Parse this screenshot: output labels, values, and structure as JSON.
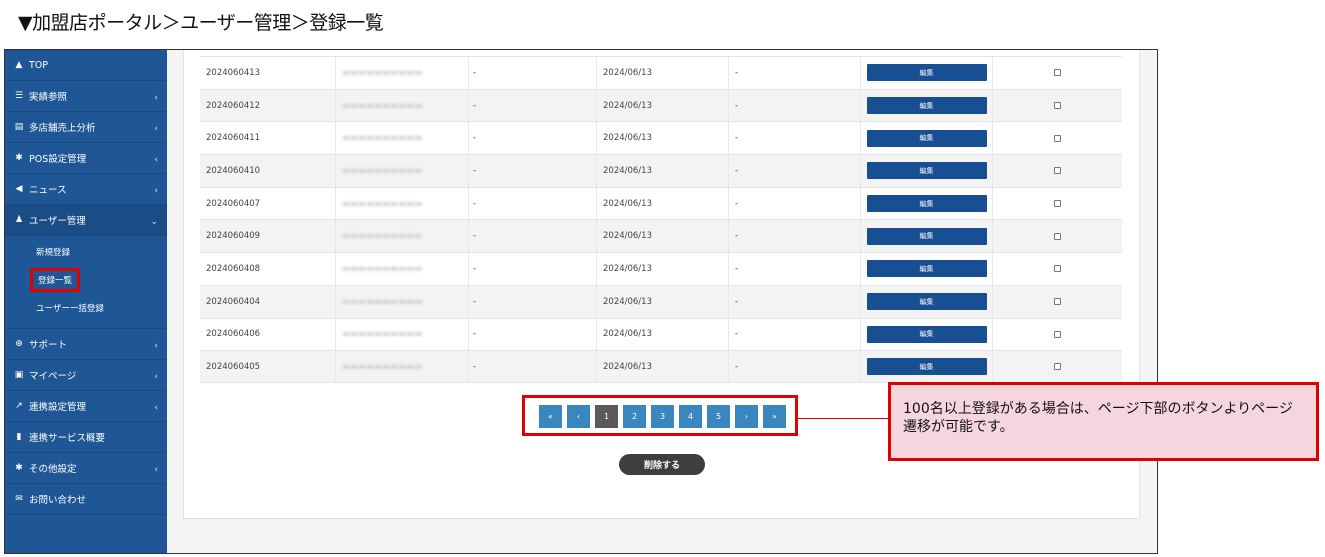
{
  "title": "▼加盟店ポータル＞ユーザー管理＞登録一覧",
  "sidebar": {
    "items": [
      {
        "icon": "▲",
        "label": "TOP",
        "chevron": ""
      },
      {
        "icon": "☰",
        "label": "実績参照",
        "chevron": "‹"
      },
      {
        "icon": "▤",
        "label": "多店舗売上分析",
        "chevron": "‹"
      },
      {
        "icon": "✱",
        "label": "POS設定管理",
        "chevron": "‹"
      },
      {
        "icon": "◀",
        "label": "ニュース",
        "chevron": "‹"
      },
      {
        "icon": "♟",
        "label": "ユーザー管理",
        "chevron": "⌄"
      }
    ],
    "submenu": [
      "新規登録",
      "登録一覧",
      "ユーザー一括登録"
    ],
    "items2": [
      {
        "icon": "⊕",
        "label": "サポート",
        "chevron": "‹"
      },
      {
        "icon": "▣",
        "label": "マイページ",
        "chevron": "‹"
      },
      {
        "icon": "↗",
        "label": "連携設定管理",
        "chevron": "‹"
      },
      {
        "icon": "▮",
        "label": "連携サービス概要",
        "chevron": ""
      },
      {
        "icon": "✱",
        "label": "その他設定",
        "chevron": "‹"
      },
      {
        "icon": "✉",
        "label": "お問い合わせ",
        "chevron": ""
      }
    ]
  },
  "table": {
    "edit_label": "編集",
    "rows": [
      {
        "id": "2024060413",
        "c3": "-",
        "date": "2024/06/13",
        "c5": "-"
      },
      {
        "id": "2024060412",
        "c3": "-",
        "date": "2024/06/13",
        "c5": "-"
      },
      {
        "id": "2024060411",
        "c3": "-",
        "date": "2024/06/13",
        "c5": "-"
      },
      {
        "id": "2024060410",
        "c3": "-",
        "date": "2024/06/13",
        "c5": "-"
      },
      {
        "id": "2024060407",
        "c3": "-",
        "date": "2024/06/13",
        "c5": "-"
      },
      {
        "id": "2024060409",
        "c3": "-",
        "date": "2024/06/13",
        "c5": "-"
      },
      {
        "id": "2024060408",
        "c3": "-",
        "date": "2024/06/13",
        "c5": "-"
      },
      {
        "id": "2024060404",
        "c3": "-",
        "date": "2024/06/13",
        "c5": "-"
      },
      {
        "id": "2024060406",
        "c3": "-",
        "date": "2024/06/13",
        "c5": "-"
      },
      {
        "id": "2024060405",
        "c3": "-",
        "date": "2024/06/13",
        "c5": "-"
      }
    ]
  },
  "pagination": {
    "buttons": [
      "«",
      "‹",
      "1",
      "2",
      "3",
      "4",
      "5",
      "›",
      "»"
    ],
    "active": "1"
  },
  "delete_label": "削除する",
  "callout": {
    "text": "100名以上登録がある場合は、ページ下部のボタンよりページ遷移が可能です。"
  },
  "colors": {
    "sidebar": "#1f5796",
    "button_primary": "#184f92",
    "pager": "#3a86bf",
    "highlight": "#e10000",
    "callout_bg": "#f6d6de"
  }
}
